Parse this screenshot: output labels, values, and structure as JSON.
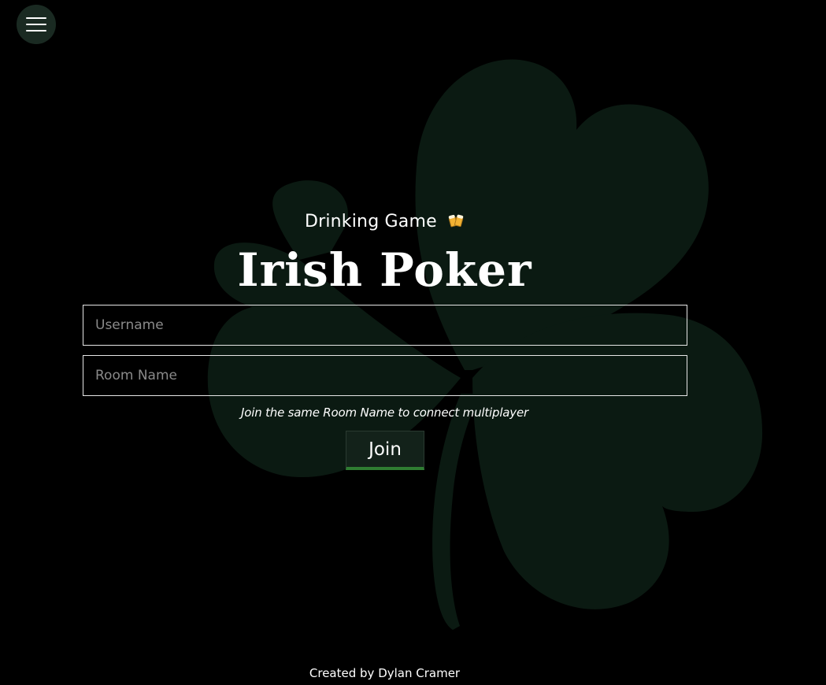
{
  "menu": {
    "icon": "hamburger-menu-icon"
  },
  "header": {
    "subtitle": "Drinking Game",
    "subtitle_icon": "beer-mugs-icon",
    "title": "Irish Poker"
  },
  "form": {
    "username_placeholder": "Username",
    "username_value": "",
    "room_placeholder": "Room Name",
    "room_value": "",
    "hint": "Join the same Room Name to connect multiplayer",
    "join_label": "Join"
  },
  "footer": {
    "credit": "Created by Dylan Cramer"
  },
  "colors": {
    "background": "#000000",
    "shamrock": "#0b1a12",
    "accent": "#2f7d32",
    "text": "#ffffff"
  }
}
